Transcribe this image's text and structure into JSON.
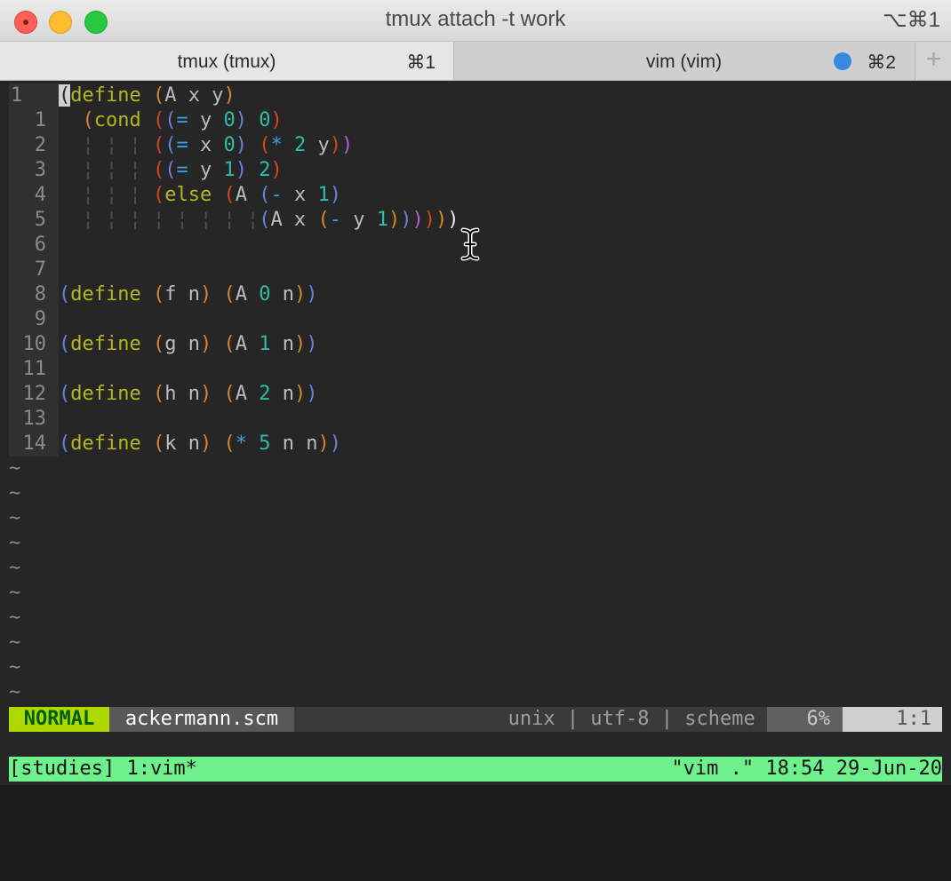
{
  "window": {
    "title": "tmux attach -t work",
    "shortcut": "⌥⌘1"
  },
  "tabs": [
    {
      "label": "tmux (tmux)",
      "shortcut": "⌘1"
    },
    {
      "label": "vim (vim)",
      "shortcut": "⌘2"
    }
  ],
  "new_tab_label": "+",
  "editor": {
    "line_numbers": [
      "1",
      "1",
      "2",
      "3",
      "4",
      "5",
      "6",
      "7",
      "8",
      "9",
      "10",
      "11",
      "12",
      "13",
      "14"
    ],
    "tilde": "~"
  },
  "statusline": {
    "mode": "NORMAL",
    "filename": "ackermann.scm",
    "fileinfo": "unix | utf-8 | scheme ",
    "percent": "6%",
    "position": "1:1"
  },
  "tmux": {
    "session": "[studies] 1:vim*",
    "right": "\"vim .\" 18:54 29-Jun-20"
  },
  "colors": {
    "mode_bg": "#afd700",
    "tmux_bar": "#6ef08c",
    "tab_dot": "#3a86e0"
  }
}
